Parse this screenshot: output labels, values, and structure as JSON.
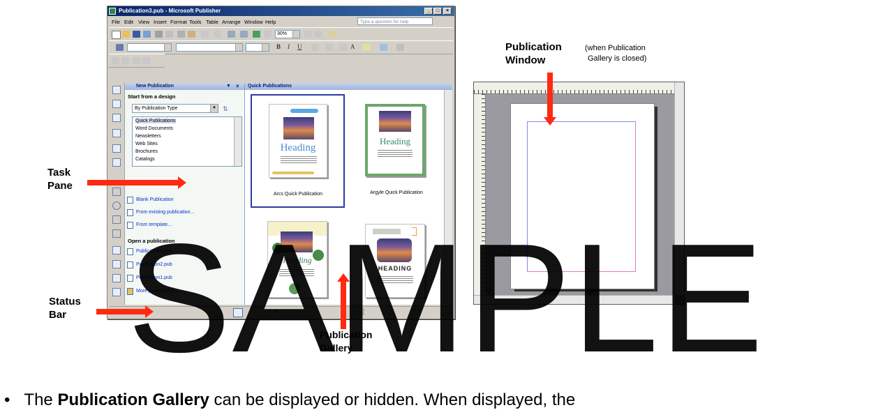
{
  "window": {
    "title": "Publication3.pub - Microsoft Publisher",
    "menu": [
      "File",
      "Edit",
      "View",
      "Insert",
      "Format",
      "Tools",
      "Table",
      "Arrange",
      "Window",
      "Help"
    ],
    "ask_placeholder": "Type a question for help",
    "zoom": "30%"
  },
  "task_pane": {
    "title": "New Publication",
    "section_design": "Start from a design",
    "design_select": "By Publication Type",
    "types": [
      "Quick Publications",
      "Word Documents",
      "Newsletters",
      "Web Sites",
      "Brochures",
      "Catalogs"
    ],
    "new_links": [
      "Blank Publication",
      "From existing publication...",
      "From template..."
    ],
    "section_open": "Open a publication",
    "open_links": [
      "Publication3.pub",
      "Publication2.pub",
      "Publication1.pub",
      "More publications..."
    ]
  },
  "gallery": {
    "title": "Quick Publications",
    "items": [
      {
        "label": "Arcs Quick Publication",
        "heading": "Heading"
      },
      {
        "label": "Argyle Quick Publication",
        "heading": "Heading"
      },
      {
        "label": "",
        "heading": "Heading"
      },
      {
        "label": "",
        "heading": "HEADING"
      }
    ]
  },
  "callouts": {
    "task_pane": "Task\nPane",
    "status_bar": "Status\nBar",
    "publication_gallery": "Publication\nGallery",
    "publication_window": "Publication\nWindow",
    "publication_window_note": "(when Publication\nGallery is closed)"
  },
  "body_text": {
    "prefix": "The ",
    "bold": "Publication Gallery",
    "suffix": " can be displayed or hidden.  When displayed, the"
  },
  "watermark": "SAMPLE",
  "colors": {
    "arrow": "#ff2a10",
    "title_bar": "#0a246a",
    "link": "#0033cc"
  }
}
